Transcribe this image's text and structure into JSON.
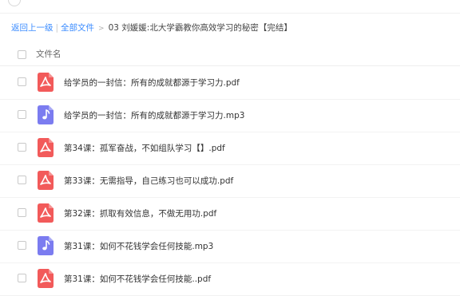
{
  "breadcrumb": {
    "back": "返回上一级",
    "all_files": "全部文件",
    "current": "03 刘媛媛:北大学霸教你高效学习的秘密【完结】"
  },
  "header": {
    "name_col": "文件名"
  },
  "colors": {
    "pdf": "#f25a5a",
    "audio": "#7b7cf0",
    "link": "#3b8cff"
  },
  "files": [
    {
      "name": "给学员的一封信：所有的成就都源于学习力.pdf",
      "type": "pdf",
      "icon": "pdf-icon"
    },
    {
      "name": "给学员的一封信：所有的成就都源于学习力.mp3",
      "type": "audio",
      "icon": "music-note-icon"
    },
    {
      "name": "第34课：孤军奋战，不如组队学习【】.pdf",
      "type": "pdf",
      "icon": "pdf-icon"
    },
    {
      "name": "第33课：无需指导，自己练习也可以成功.pdf",
      "type": "pdf",
      "icon": "pdf-icon"
    },
    {
      "name": "第32课：抓取有效信息，不做无用功.pdf",
      "type": "pdf",
      "icon": "pdf-icon"
    },
    {
      "name": "第31课：如何不花钱学会任何技能.mp3",
      "type": "audio",
      "icon": "music-note-icon"
    },
    {
      "name": "第31课：如何不花钱学会任何技能..pdf",
      "type": "pdf",
      "icon": "pdf-icon"
    }
  ]
}
